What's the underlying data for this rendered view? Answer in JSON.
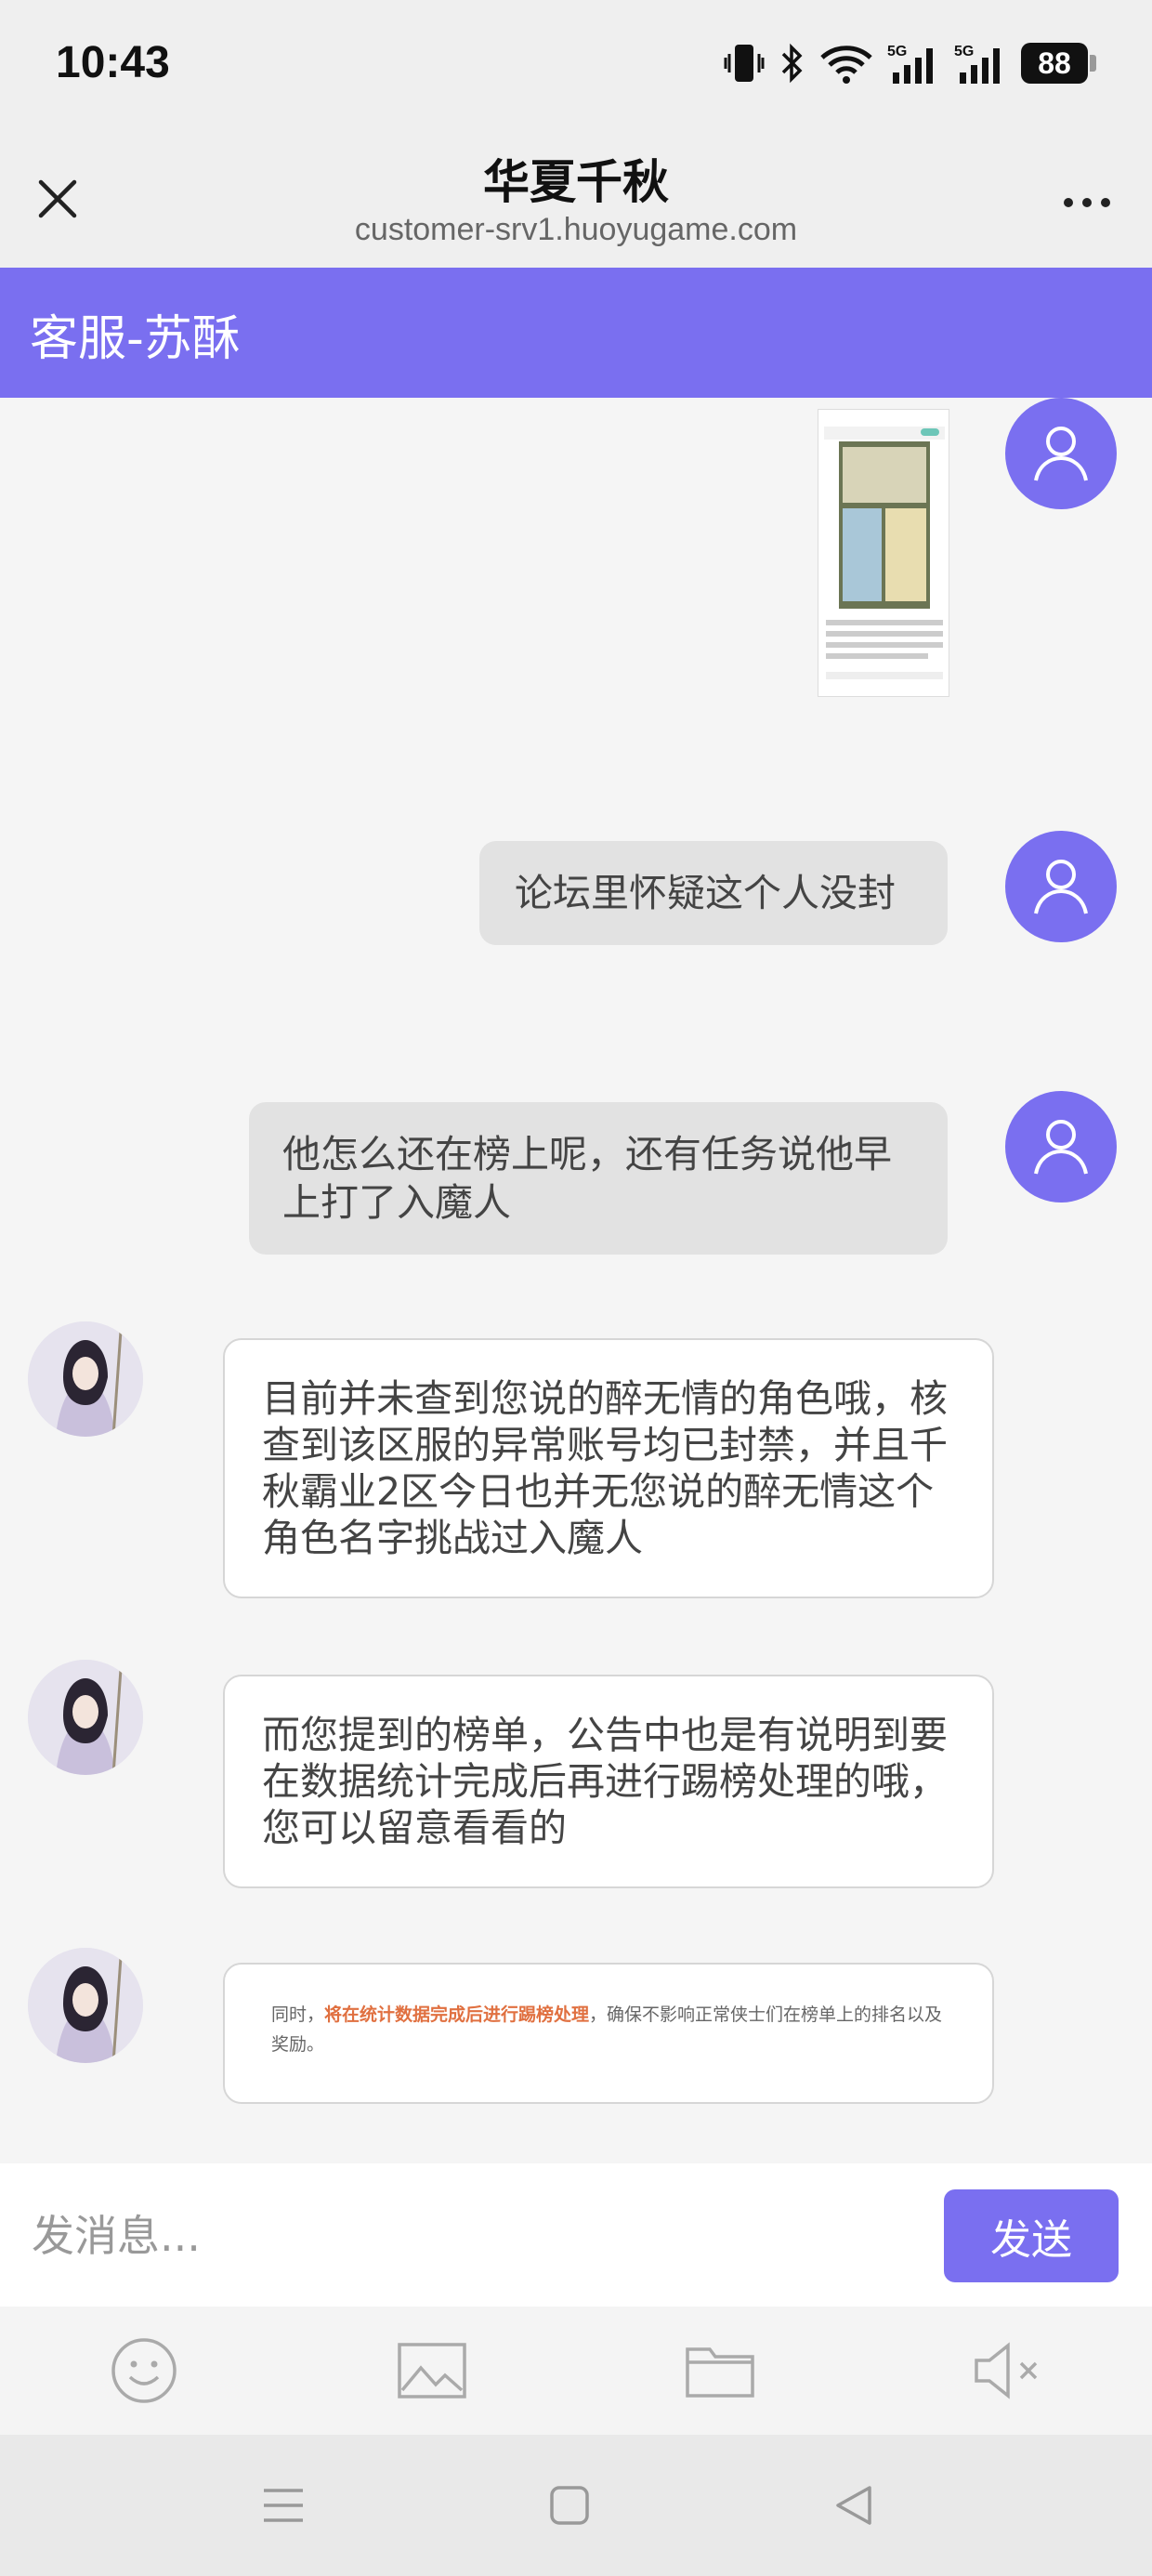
{
  "status_bar": {
    "time": "10:43",
    "battery": "88",
    "network_1": "5G",
    "network_2": "5G"
  },
  "browser": {
    "title": "华夏千秋",
    "url": "customer-srv1.huoyugame.com"
  },
  "agent_bar": {
    "name": "客服-苏酥"
  },
  "messages": [
    {
      "from": "user",
      "type": "image"
    },
    {
      "from": "user",
      "text": "论坛里怀疑这个人没封"
    },
    {
      "from": "user",
      "text": "他怎么还在榜上呢，还有任务说他早上打了入魔人"
    },
    {
      "from": "agent",
      "text": "目前并未查到您说的醉无情的角色哦，核查到该区服的异常账号均已封禁，并且千秋霸业2区今日也并无您说的醉无情这个角色名字挑战过入魔人"
    },
    {
      "from": "agent",
      "text": "而您提到的榜单，公告中也是有说明到要在数据统计完成后再进行踢榜处理的哦，您可以留意看看的"
    },
    {
      "from": "agent",
      "type": "image",
      "snippet_prefix": "同时，",
      "snippet_highlight": "将在统计数据完成后进行踢榜处理",
      "snippet_suffix": "，确保不影响正常侠士们在榜单上的排名以及奖励。"
    }
  ],
  "input": {
    "placeholder": "发消息...",
    "send_label": "发送"
  },
  "toolbar": {
    "icons": [
      "emoji-icon",
      "image-icon",
      "folder-icon",
      "mute-icon"
    ]
  },
  "colors": {
    "accent": "#7a6ff0",
    "highlight": "#e07040",
    "user_bubble": "#e2e2e2",
    "agent_bubble": "#ffffff"
  }
}
